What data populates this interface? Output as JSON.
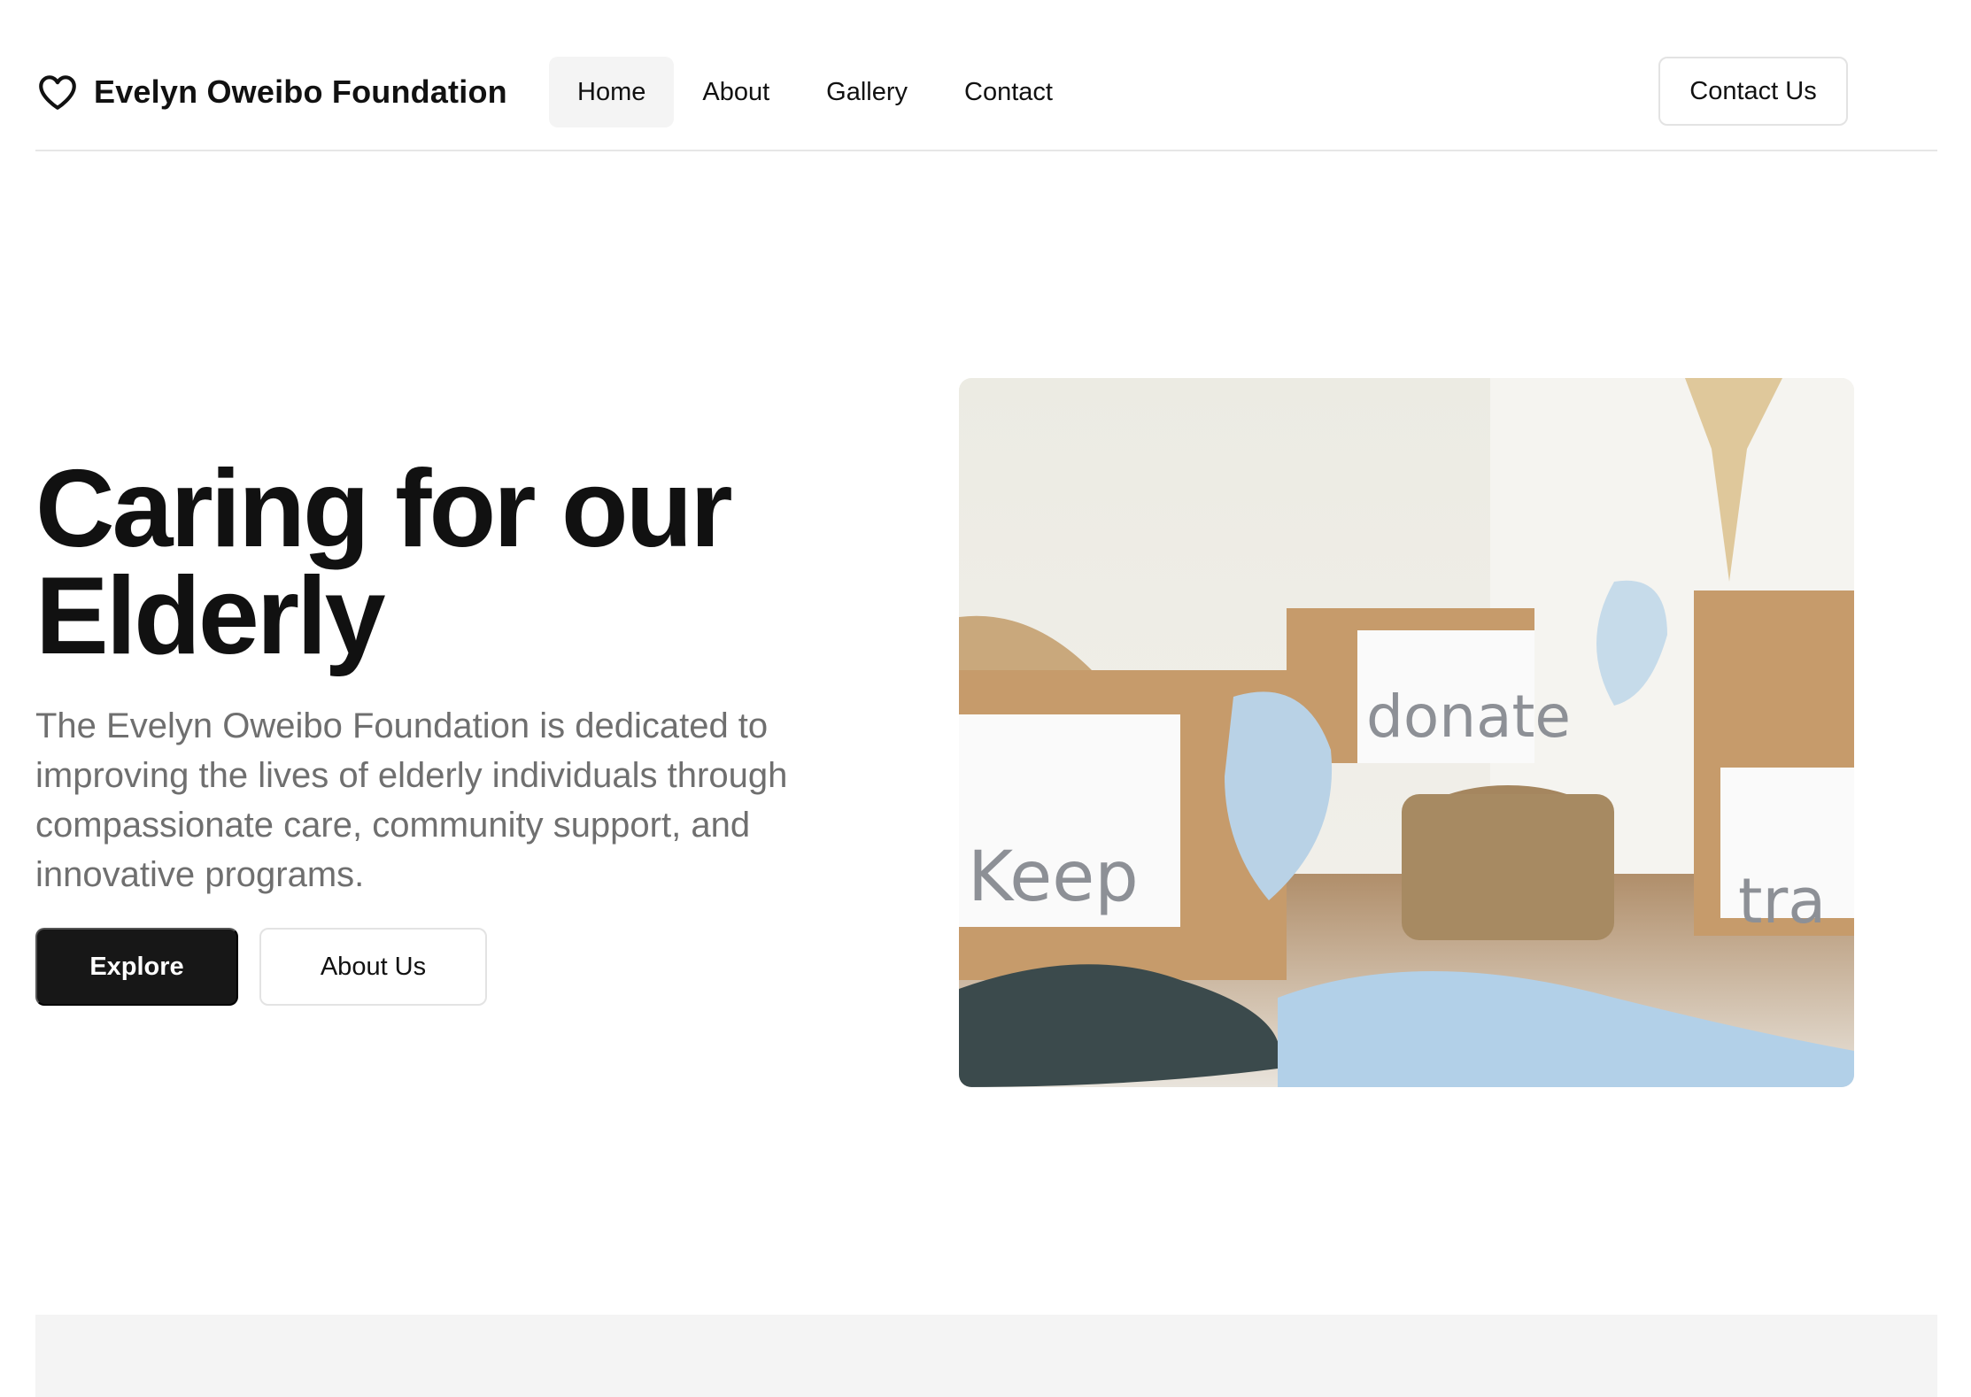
{
  "brand": {
    "name": "Evelyn Oweibo Foundation",
    "icon": "heart-icon"
  },
  "nav": {
    "items": [
      {
        "label": "Home",
        "active": true
      },
      {
        "label": "About"
      },
      {
        "label": "Gallery"
      },
      {
        "label": "Contact"
      }
    ]
  },
  "header": {
    "cta_label": "Contact Us"
  },
  "hero": {
    "title_line1": "Caring for our",
    "title_line2": "Elderly",
    "description": "The Evelyn Oweibo Foundation is dedicated to improving the lives of elderly individuals through compassionate care, community support, and innovative programs.",
    "primary_button": "Explore",
    "secondary_button": "About Us",
    "image_labels": {
      "box_left": "Keep",
      "box_center": "donate",
      "box_right": "tra"
    }
  },
  "colors": {
    "primary_button_bg": "#171717",
    "active_nav_bg": "#f4f4f4",
    "muted_text": "#6f6f6f",
    "footer_band": "#f4f4f4"
  }
}
